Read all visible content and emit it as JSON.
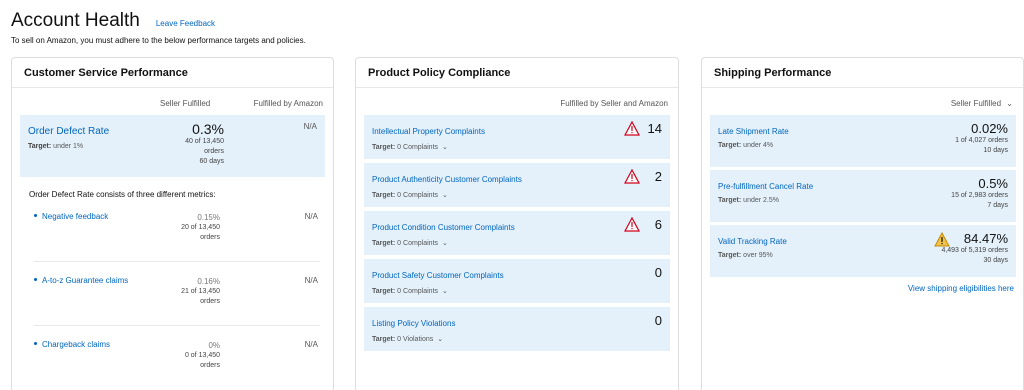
{
  "header": {
    "title": "Account Health",
    "feedback": "Leave Feedback",
    "subtitle": "To sell on Amazon, you must adhere to the below performance targets and policies."
  },
  "customer_service": {
    "title": "Customer Service Performance",
    "col_seller": "Seller Fulfilled",
    "col_fba": "Fulfilled by Amazon",
    "odr": {
      "name": "Order Defect Rate",
      "target_label": "Target:",
      "target_value": "under 1%",
      "value": "0.3%",
      "orders_line1": "40 of 13,450",
      "orders_line2": "orders",
      "days": "60 days",
      "fba": "N/A"
    },
    "consists": "Order Defect Rate consists of three different metrics:",
    "metrics": [
      {
        "name": "Negative feedback",
        "pct": "0.15%",
        "line1": "20 of 13,450",
        "line2": "orders",
        "fba": "N/A"
      },
      {
        "name": "A-to-z Guarantee claims",
        "pct": "0.16%",
        "line1": "21 of 13,450",
        "line2": "orders",
        "fba": "N/A"
      },
      {
        "name": "Chargeback claims",
        "pct": "0%",
        "line1": "0 of 13,450",
        "line2": "orders",
        "fba": "N/A"
      }
    ]
  },
  "policy": {
    "title": "Product Policy Compliance",
    "col": "Fulfilled by Seller and Amazon",
    "items": [
      {
        "name": "Intellectual Property Complaints",
        "target_label": "Target:",
        "target_value": "0 Complaints",
        "count": "14"
      },
      {
        "name": "Product Authenticity Customer Complaints",
        "target_label": "Target:",
        "target_value": "0 Complaints",
        "count": "2"
      },
      {
        "name": "Product Condition Customer Complaints",
        "target_label": "Target:",
        "target_value": "0 Complaints",
        "count": "6"
      },
      {
        "name": "Product Safety Customer Complaints",
        "target_label": "Target:",
        "target_value": "0 Complaints",
        "count": "0"
      },
      {
        "name": "Listing Policy Violations",
        "target_label": "Target:",
        "target_value": "0 Violations",
        "count": "0"
      }
    ]
  },
  "shipping": {
    "title": "Shipping Performance",
    "col": "Seller Fulfilled",
    "items": [
      {
        "name": "Late Shipment Rate",
        "target_label": "Target:",
        "target_value": "under 4%",
        "value": "0.02%",
        "line1": "1 of 4,027 orders",
        "days": "10 days"
      },
      {
        "name": "Pre-fulfillment Cancel Rate",
        "target_label": "Target:",
        "target_value": "under 2.5%",
        "value": "0.5%",
        "line1": "15 of 2,983 orders",
        "days": "7 days"
      },
      {
        "name": "Valid Tracking Rate",
        "target_label": "Target:",
        "target_value": "over 95%",
        "value": "84.47%",
        "line1": "4,493 of 5,319 orders",
        "days": "30 days"
      }
    ],
    "link": "View shipping eligibilities here"
  },
  "colors": {
    "link": "#0066c0",
    "highlight": "#e4f0fa",
    "warn_red": "#d0021b",
    "warn_yellow": "#f0c14b"
  }
}
